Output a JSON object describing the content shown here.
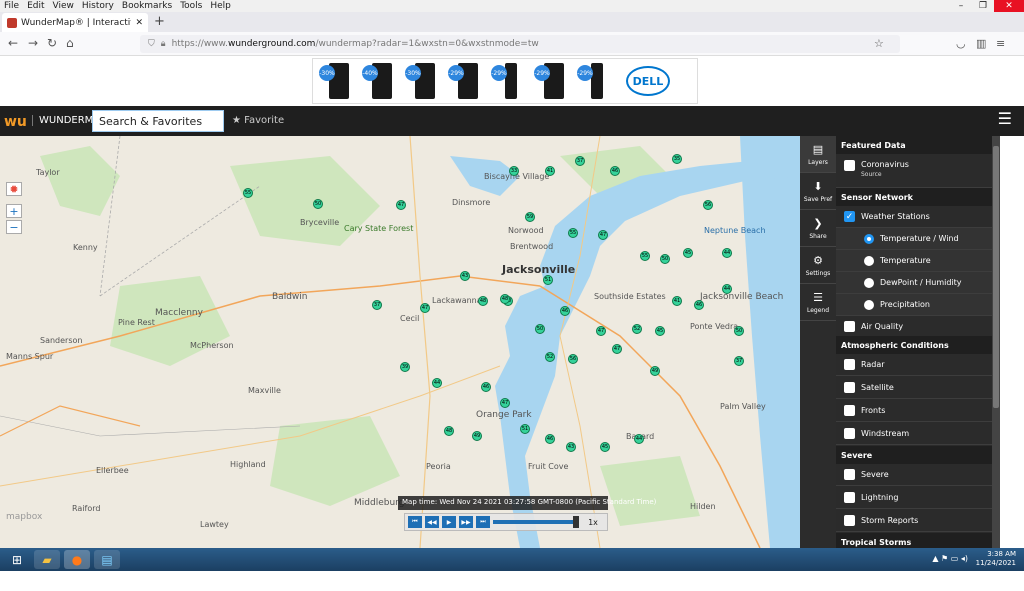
{
  "browser": {
    "menu": [
      "File",
      "Edit",
      "View",
      "History",
      "Bookmarks",
      "Tools",
      "Help"
    ],
    "tab_title": "WunderMap® | Interactive We...",
    "url_prefix": "https://www.",
    "url_host": "wunderground.com",
    "url_path": "/wundermap?radar=1&wxstn=0&wxstnmode=tw"
  },
  "ad": {
    "discounts": [
      "-30%",
      "-40%",
      "-30%",
      "-29%",
      "-29%",
      "-29%",
      "-29%"
    ],
    "brand": "DELL"
  },
  "header": {
    "brand": "WUNDERMAP",
    "search_value": "Search & Favorites",
    "favorite_label": "Favorite"
  },
  "map": {
    "cities": [
      {
        "name": "Jacksonville",
        "big": true
      },
      {
        "name": "Baldwin"
      },
      {
        "name": "Macclenny"
      },
      {
        "name": "Sanderson"
      },
      {
        "name": "Middleburg"
      },
      {
        "name": "Orange Park"
      },
      {
        "name": "Jacksonville Beach"
      },
      {
        "name": "Palm Valley"
      },
      {
        "name": "Cary State Forest"
      },
      {
        "name": "Bryceville"
      },
      {
        "name": "Dinsmore"
      },
      {
        "name": "Biscayne Village"
      },
      {
        "name": "Maxville"
      },
      {
        "name": "McPherson"
      },
      {
        "name": "Highland"
      },
      {
        "name": "Lawtey"
      },
      {
        "name": "Raiford"
      },
      {
        "name": "Ellerbee"
      },
      {
        "name": "Taylor"
      },
      {
        "name": "Kenny"
      },
      {
        "name": "Pine Rest"
      },
      {
        "name": "Manns Spur"
      },
      {
        "name": "Brentwood"
      },
      {
        "name": "Norwood"
      },
      {
        "name": "Cecil"
      },
      {
        "name": "Lackawanna"
      },
      {
        "name": "Southside Estates"
      },
      {
        "name": "Hilden"
      },
      {
        "name": "Bayard"
      },
      {
        "name": "Fruit Cove"
      },
      {
        "name": "Peoria"
      },
      {
        "name": "Ponte Vedra"
      },
      {
        "name": "Neptune Beach"
      }
    ],
    "stations": [
      "55",
      "50",
      "47",
      "33",
      "41",
      "37",
      "46",
      "35",
      "56",
      "59",
      "55",
      "47",
      "45",
      "44",
      "55",
      "50",
      "51",
      "40",
      "43",
      "47",
      "48",
      "48",
      "37",
      "50",
      "46",
      "47",
      "52",
      "41",
      "46",
      "44",
      "50",
      "45",
      "52",
      "56",
      "47",
      "39",
      "44",
      "46",
      "47",
      "48",
      "49",
      "51",
      "46",
      "43",
      "45",
      "44",
      "49",
      "37"
    ],
    "attribution": "mapbox",
    "time_label": "Map time: Wed Nov 24 2021 03:27:58 GMT-0800 (Pacific Standard Time)",
    "speed": "1x"
  },
  "iconbar": [
    "Layers",
    "Save Pref",
    "Share",
    "Settings",
    "Legend"
  ],
  "panel": {
    "featured": "Featured Data",
    "coronavirus": "Coronavirus",
    "source": "Source",
    "sensor": "Sensor Network",
    "weather_stations": "Weather Stations",
    "temp_wind": "Temperature / Wind",
    "temperature": "Temperature",
    "dewpoint": "DewPoint / Humidity",
    "precip": "Precipitation",
    "air": "Air Quality",
    "atmos": "Atmospheric Conditions",
    "radar": "Radar",
    "satellite": "Satellite",
    "fronts": "Fronts",
    "windstream": "Windstream",
    "severe_h": "Severe",
    "severe": "Severe",
    "lightning": "Lightning",
    "storm": "Storm Reports",
    "tropical": "Tropical Storms"
  },
  "taskbar": {
    "time": "3:38 AM",
    "date": "11/24/2021"
  },
  "colors": {
    "water": "#a8d5f0",
    "land": "#eeeae0",
    "station_fill": "#35d29a",
    "accent": "#2196f3"
  }
}
